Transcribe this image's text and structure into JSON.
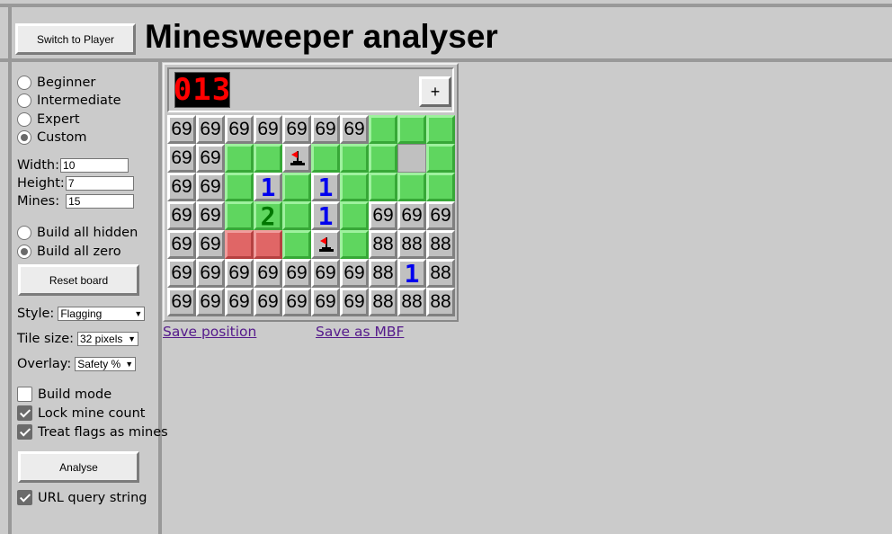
{
  "header": {
    "switch_label": "Switch to Player",
    "title": "Minesweeper analyser"
  },
  "difficulty": [
    "Beginner",
    "Intermediate",
    "Expert",
    "Custom"
  ],
  "selected_difficulty": 3,
  "size": {
    "width_label": "Width:",
    "width_value": "10",
    "height_label": "Height:",
    "height_value": "7",
    "mines_label": "Mines:",
    "mines_value": "15"
  },
  "build": {
    "hidden_label": "Build all hidden",
    "zero_label": "Build all zero",
    "selected": 1
  },
  "reset_label": "Reset board",
  "style": {
    "label": "Style:",
    "value": "Flagging"
  },
  "tile_size": {
    "label": "Tile size:",
    "value": "32 pixels"
  },
  "overlay": {
    "label": "Overlay:",
    "value": "Safety %"
  },
  "options": {
    "build_mode": "Build mode",
    "build_mode_checked": false,
    "lock_mine_count": "Lock mine count",
    "lock_mine_count_checked": true,
    "treat_flags": "Treat flags as mines",
    "treat_flags_checked": true
  },
  "analyse_label": "Analyse",
  "url_query": {
    "label": "URL query string",
    "checked": true
  },
  "board": {
    "counter": "013",
    "add_label": "+",
    "rows": [
      [
        "69",
        "69",
        "69",
        "69",
        "69",
        "69",
        "69",
        "G",
        "G",
        "G"
      ],
      [
        "69",
        "69",
        "G",
        "G",
        "F",
        "G",
        "G",
        "G",
        "O",
        "G"
      ],
      [
        "69",
        "69",
        "G",
        "1",
        "G",
        "1",
        "G",
        "G",
        "G",
        "G"
      ],
      [
        "69",
        "69",
        "G",
        "2",
        "G",
        "1",
        "G",
        "69",
        "69",
        "69"
      ],
      [
        "69",
        "69",
        "R",
        "R",
        "G",
        "F",
        "G",
        "88",
        "88",
        "88"
      ],
      [
        "69",
        "69",
        "69",
        "69",
        "69",
        "69",
        "69",
        "88",
        "1",
        "88"
      ],
      [
        "69",
        "69",
        "69",
        "69",
        "69",
        "69",
        "69",
        "88",
        "88",
        "88"
      ]
    ]
  },
  "links": {
    "save_position": "Save position",
    "save_mbf": "Save as MBF"
  }
}
